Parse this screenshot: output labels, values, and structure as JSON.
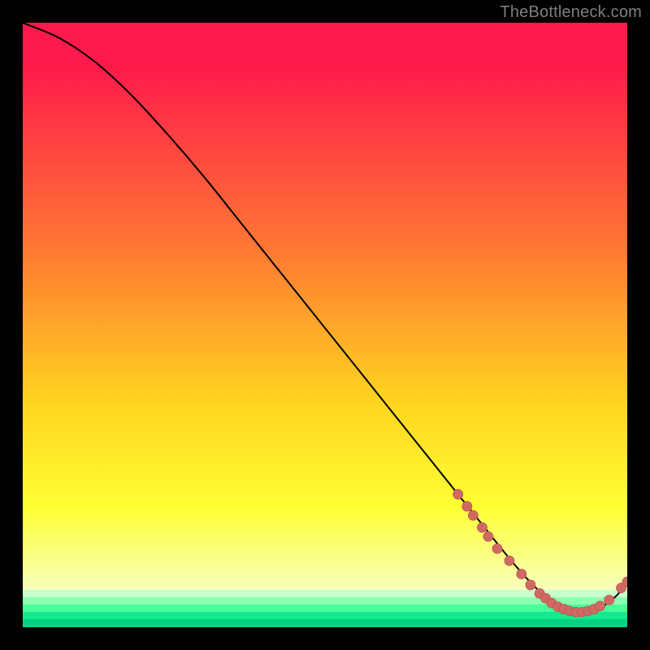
{
  "attribution": "TheBottleneck.com",
  "colors": {
    "page_bg": "#000000",
    "text": "#7f7f7f",
    "curve": "#000000",
    "marker_fill": "#cf6a63",
    "marker_stroke": "#b9544f",
    "grad_top": "#ff1a4b",
    "grad_mid1": "#ff7a33",
    "grad_mid2": "#ffd21f",
    "grad_mid3": "#ffff33",
    "grad_low": "#f7ffba",
    "green1": "#c9ffcb",
    "green2": "#8dffb0",
    "green3": "#49ff9c",
    "green4": "#16e98d",
    "green5": "#00d480"
  },
  "chart_data": {
    "type": "line",
    "title": "",
    "xlabel": "",
    "ylabel": "",
    "xlim": [
      0,
      100
    ],
    "ylim": [
      0,
      100
    ],
    "series": [
      {
        "name": "bottleneck-curve",
        "x": [
          0,
          6,
          12,
          18,
          24,
          30,
          36,
          42,
          48,
          54,
          60,
          66,
          72,
          76,
          80,
          83,
          86,
          89,
          92,
          95,
          98,
          100
        ],
        "y": [
          100,
          97.5,
          93.5,
          88,
          81.5,
          74.5,
          67,
          59.5,
          52,
          44.5,
          37,
          29.5,
          22,
          17,
          12,
          8.5,
          5.5,
          3.5,
          2.5,
          3,
          5,
          7.5
        ]
      }
    ],
    "markers": [
      {
        "x": 72,
        "y": 22
      },
      {
        "x": 73.5,
        "y": 20
      },
      {
        "x": 74.5,
        "y": 18.5
      },
      {
        "x": 76,
        "y": 16.5
      },
      {
        "x": 77,
        "y": 15
      },
      {
        "x": 78.5,
        "y": 13
      },
      {
        "x": 80.5,
        "y": 11
      },
      {
        "x": 82.5,
        "y": 8.8
      },
      {
        "x": 84,
        "y": 7
      },
      {
        "x": 85.5,
        "y": 5.6
      },
      {
        "x": 86.5,
        "y": 4.8
      },
      {
        "x": 87.5,
        "y": 4
      },
      {
        "x": 88.5,
        "y": 3.4
      },
      {
        "x": 89.5,
        "y": 3
      },
      {
        "x": 90.5,
        "y": 2.7
      },
      {
        "x": 91.5,
        "y": 2.5
      },
      {
        "x": 92.5,
        "y": 2.5
      },
      {
        "x": 93.5,
        "y": 2.7
      },
      {
        "x": 94.5,
        "y": 3
      },
      {
        "x": 95.5,
        "y": 3.5
      },
      {
        "x": 97,
        "y": 4.5
      },
      {
        "x": 99,
        "y": 6.5
      },
      {
        "x": 100,
        "y": 7.5
      }
    ]
  }
}
